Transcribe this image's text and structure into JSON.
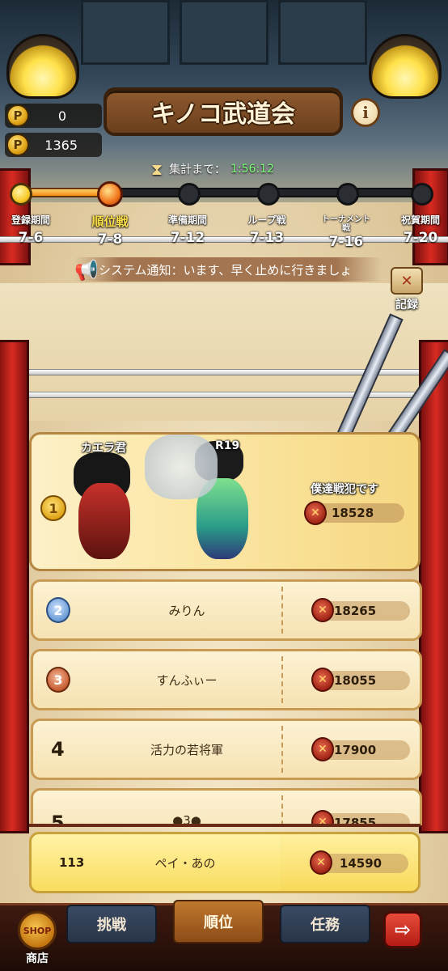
{
  "header": {
    "title": "キノコ武道会",
    "info_glyph": "i",
    "currencies": [
      {
        "icon": "coin-icon",
        "value": "0"
      },
      {
        "icon": "ticket-coin-icon",
        "value": "1365"
      }
    ],
    "timer_label": "集計まで：",
    "timer_value": "1:56:12"
  },
  "schedule": {
    "progress": 0.24,
    "phases": [
      {
        "name": "登録期間",
        "date": "7-6",
        "state": "done"
      },
      {
        "name": "順位戦",
        "date": "7-8",
        "state": "current"
      },
      {
        "name": "準備期間",
        "date": "7-12",
        "state": "upcoming"
      },
      {
        "name": "ループ戦",
        "date": "7-13",
        "state": "upcoming"
      },
      {
        "name": "トーナメント戦",
        "date": "7-16",
        "state": "upcoming"
      },
      {
        "name": "祝賀期間",
        "date": "7-20",
        "state": "upcoming"
      }
    ]
  },
  "notice": {
    "text": "システム通知：います、早く止めに行きましょ"
  },
  "record_button": {
    "label": "記録"
  },
  "ranking": {
    "top1": {
      "rank": "1",
      "player_name": "カエラ君",
      "partner_name": "R19",
      "guild_name": "僕達戦犯です",
      "score": "18528"
    },
    "rows": [
      {
        "rank": "2",
        "name": "みりん",
        "score": "18265",
        "medal": "silver"
      },
      {
        "rank": "3",
        "name": "すんふぃー",
        "score": "18055",
        "medal": "bronze"
      },
      {
        "rank": "4",
        "name": "活力の若将軍",
        "score": "17900",
        "medal": "none"
      },
      {
        "rank": "5",
        "name": "●3●",
        "score": "17855",
        "medal": "none"
      }
    ],
    "my_row": {
      "rank": "113",
      "name": "ペイ・あの",
      "score": "14590"
    }
  },
  "bottom_nav": {
    "shop_badge": "SHOP",
    "shop_label": "商店",
    "tabs": [
      "挑戦",
      "順位",
      "任務"
    ],
    "active_tab": "順位"
  },
  "colors": {
    "accent_gold": "#f7c928",
    "active_node": "#f1741b",
    "timer_green": "#7dff7a",
    "exit_red": "#e84b3a"
  }
}
